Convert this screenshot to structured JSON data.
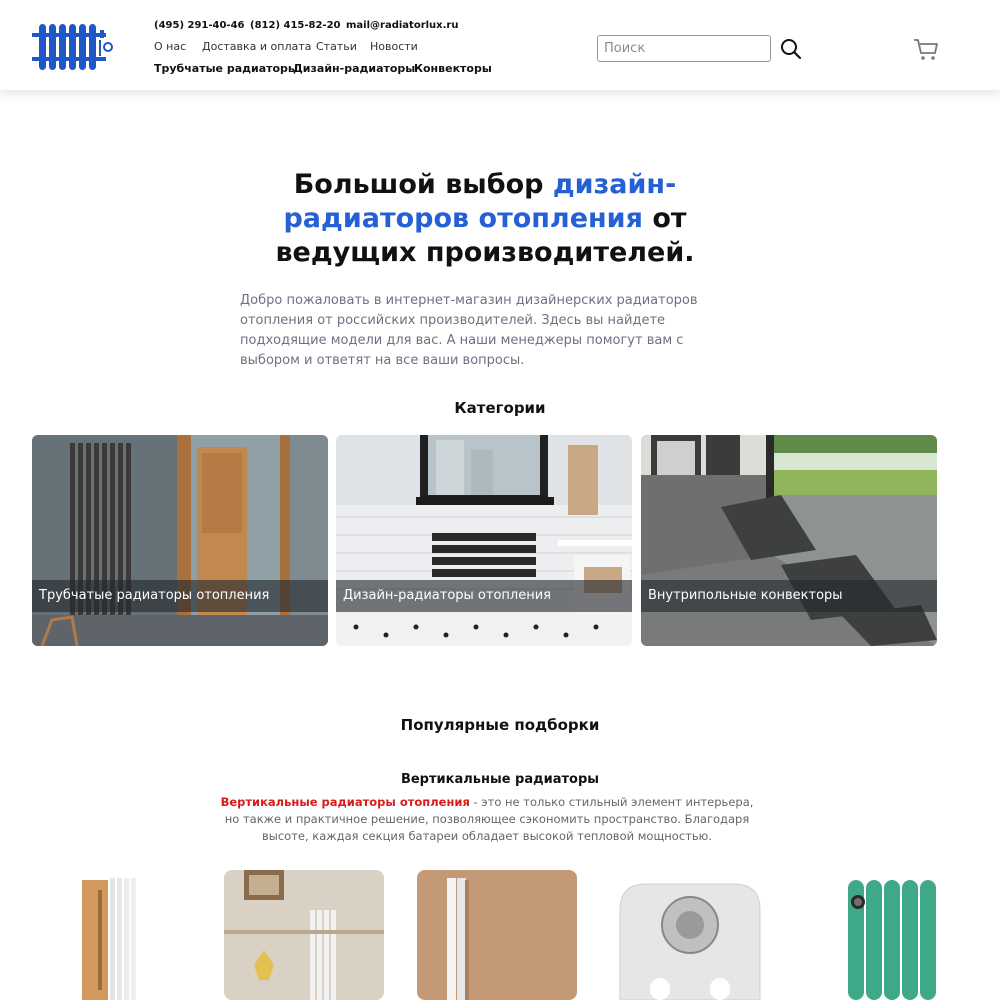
{
  "header": {
    "logo_icon": "radiator-logo-icon",
    "phone1": "(495) 291-40-46",
    "phone2": "(812) 415-82-20",
    "email": "mail@radiatorlux.ru",
    "nav": [
      "О нас",
      "Доставка и оплата",
      "Статьи",
      "Новости"
    ],
    "categories": [
      "Трубчатые радиаторы",
      "Дизайн-радиаторы",
      "Конвекторы"
    ],
    "search_placeholder": "Поиск",
    "search_icon": "search-icon",
    "cart_icon": "cart-icon"
  },
  "hero": {
    "title_part1": "Большой выбор ",
    "title_accent": "дизайн-радиаторов отопления",
    "title_part2": " от ведущих производителей.",
    "text": "Добро пожаловать в интернет-магазин дизайнерских радиаторов отопления от российских производителей. Здесь вы найдете подходящие модели для вас. А наши менеджеры помогут вам с выбором и ответят на все ваши вопросы."
  },
  "categories_section": {
    "title": "Категории",
    "cards": [
      {
        "label": "Трубчатые радиаторы отопления"
      },
      {
        "label": "Дизайн-радиаторы отопления"
      },
      {
        "label": "Внутрипольные конвекторы"
      }
    ]
  },
  "popular": {
    "title": "Популярные подборки",
    "subtitle": "Вертикальные радиаторы",
    "desc_highlight": "Вертикальные радиаторы отопления",
    "desc_rest": " - это не только стильный элемент интерьера, но также и практичное решение, позволяющее сэкономить пространство. Благодаря высоте, каждая секция батареи обладает высокой тепловой мощностью."
  },
  "colors": {
    "accent": "#2560d6",
    "highlight_red": "#d81b1b",
    "logo_blue": "#1f57c8"
  }
}
